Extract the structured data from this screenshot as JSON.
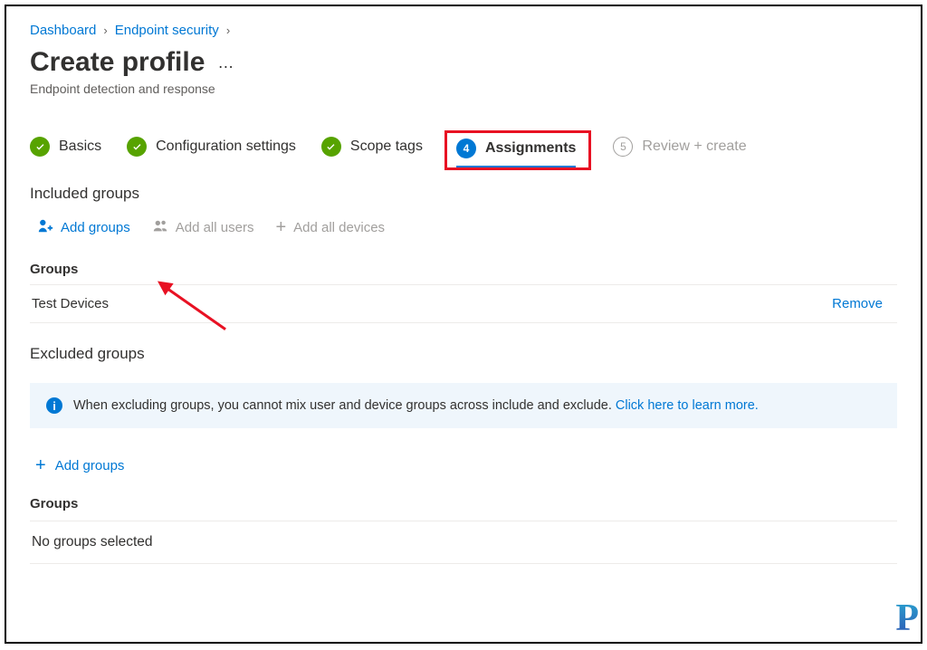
{
  "breadcrumbs": [
    {
      "label": "Dashboard"
    },
    {
      "label": "Endpoint security"
    }
  ],
  "page": {
    "title": "Create profile",
    "subtitle": "Endpoint detection and response"
  },
  "steps": {
    "basics": "Basics",
    "config": "Configuration settings",
    "scope": "Scope tags",
    "assign": "Assignments",
    "assign_num": "4",
    "review": "Review + create",
    "review_num": "5"
  },
  "included": {
    "heading": "Included groups",
    "add_groups": "Add groups",
    "add_users": "Add all users",
    "add_devices": "Add all devices",
    "groups_label": "Groups",
    "rows": [
      {
        "name": "Test Devices",
        "remove": "Remove"
      }
    ]
  },
  "excluded": {
    "heading": "Excluded groups",
    "info_text": "When excluding groups, you cannot mix user and device groups across include and exclude. ",
    "info_link": "Click here to learn more.",
    "add_groups": "Add groups",
    "groups_label": "Groups",
    "empty": "No groups selected"
  }
}
